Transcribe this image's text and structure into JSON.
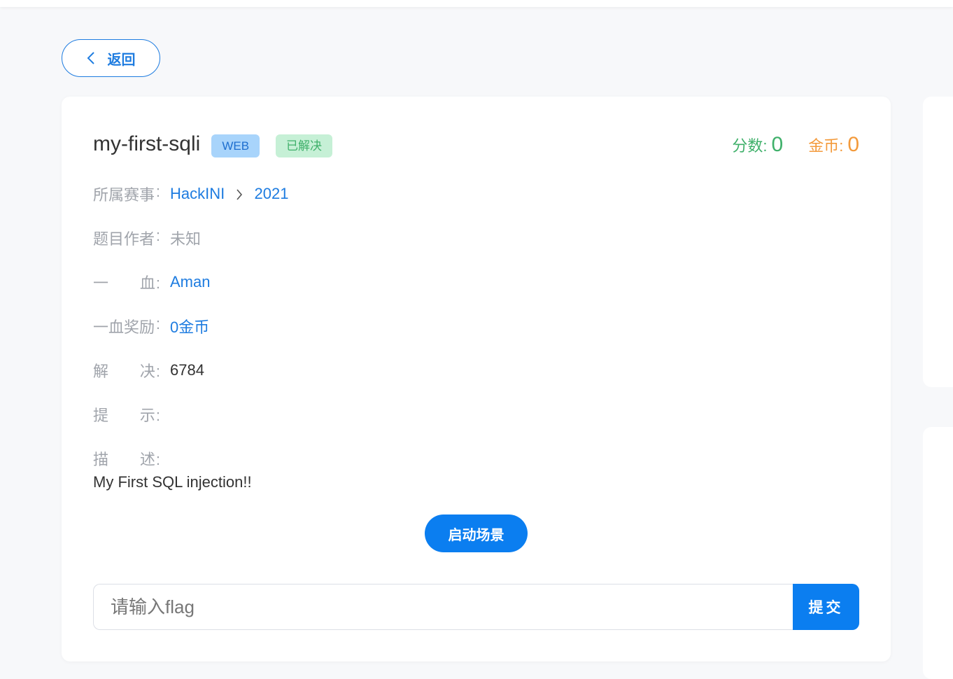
{
  "back": {
    "label": "返回"
  },
  "challenge": {
    "title": "my-first-sqli",
    "category_tag": "WEB",
    "status_tag": "已解决",
    "score_label": "分数:",
    "score_value": "0",
    "coin_label": "金币:",
    "coin_value": "0"
  },
  "info": {
    "event": {
      "label_a": "所属赛事",
      "colon": ":",
      "event_name": "HackINI",
      "event_year": "2021"
    },
    "author": {
      "label_a": "题目作者",
      "colon": ":",
      "value": "未知"
    },
    "first_blood": {
      "label_a": "一",
      "label_b": "血",
      "colon": ":",
      "value": "Aman"
    },
    "first_blood_reward": {
      "label_a": "一血奖励",
      "colon": ":",
      "value": "0金币"
    },
    "solves": {
      "label_a": "解",
      "label_b": "决",
      "colon": ":",
      "value": "6784"
    },
    "hint": {
      "label_a": "提",
      "label_b": "示",
      "colon": ":",
      "value": ""
    },
    "description": {
      "label_a": "描",
      "label_b": "述",
      "colon": ":",
      "value": "My First SQL injection!!"
    }
  },
  "actions": {
    "launch_label": "启动场景",
    "flag_placeholder": "请输入flag",
    "submit_label": "提交"
  },
  "colors": {
    "accent": "#0b7ef0",
    "success": "#3fb06a",
    "coin": "#f39a3b"
  }
}
